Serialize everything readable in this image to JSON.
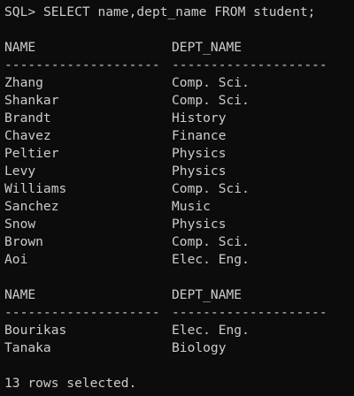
{
  "terminal": {
    "prompt": "SQL> ",
    "command": "SELECT name,dept_name FROM student;",
    "text_color": "#cccccc",
    "background_color": "#0c0c0c"
  },
  "result_block_1": {
    "headers": [
      "NAME",
      "DEPT_NAME"
    ],
    "separators": [
      "--------------------",
      "--------------------"
    ],
    "rows": [
      [
        "Zhang",
        "Comp. Sci."
      ],
      [
        "Shankar",
        "Comp. Sci."
      ],
      [
        "Brandt",
        "History"
      ],
      [
        "Chavez",
        "Finance"
      ],
      [
        "Peltier",
        "Physics"
      ],
      [
        "Levy",
        "Physics"
      ],
      [
        "Williams",
        "Comp. Sci."
      ],
      [
        "Sanchez",
        "Music"
      ],
      [
        "Snow",
        "Physics"
      ],
      [
        "Brown",
        "Comp. Sci."
      ],
      [
        "Aoi",
        "Elec. Eng."
      ]
    ]
  },
  "result_block_2": {
    "headers": [
      "NAME",
      "DEPT_NAME"
    ],
    "separators": [
      "--------------------",
      "--------------------"
    ],
    "rows": [
      [
        "Bourikas",
        "Elec. Eng."
      ],
      [
        "Tanaka",
        "Biology"
      ]
    ]
  },
  "footer": {
    "summary": "13 rows selected."
  }
}
